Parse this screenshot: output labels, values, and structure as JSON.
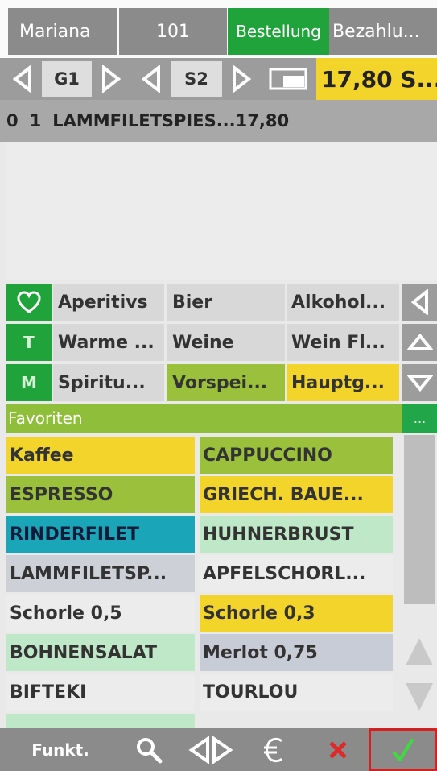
{
  "header": {
    "waiter": "Mariana",
    "table": "101",
    "tabs": [
      {
        "label": "Bestellung",
        "active": true
      },
      {
        "label": "Bezahlu...",
        "active": false
      }
    ]
  },
  "nav": {
    "group_label": "G1",
    "seat_label": "S2",
    "total": "17,80 S..."
  },
  "order": {
    "items": [
      {
        "col0": "0",
        "qty": "1",
        "name": "LAMMFILETSPIES...",
        "price": "17,80"
      }
    ]
  },
  "categories": {
    "rows": [
      {
        "icon": "heart-icon",
        "icon_text": "♡",
        "items": [
          "Aperitivs",
          "Bier",
          "Alkohol..."
        ]
      },
      {
        "icon": "t-icon",
        "icon_text": "T",
        "items": [
          "Warme ...",
          "Weine",
          "Wein Fl..."
        ]
      },
      {
        "icon": "m-icon",
        "icon_text": "M",
        "items": [
          "Spiritu...",
          "Vorspei...",
          "Hauptg..."
        ]
      }
    ],
    "favorites_label": "Favoriten",
    "favorites_more": "..."
  },
  "products": [
    {
      "label": "Kaffee",
      "color": "#f2d42a"
    },
    {
      "label": "CAPPUCCINO",
      "color": "#9bc13c"
    },
    {
      "label": "ESPRESSO",
      "color": "#9bc13c"
    },
    {
      "label": "GRIECH. BAUE...",
      "color": "#f2d42a"
    },
    {
      "label": "RINDERFILET",
      "color": "#1aa6b8"
    },
    {
      "label": "HUHNERBRUST",
      "color": "#bfe8c8"
    },
    {
      "label": "LAMMFILETSP...",
      "color": "#cdd0d6"
    },
    {
      "label": "APFELSCHORL...",
      "color": "#ececec"
    },
    {
      "label": "Schorle 0,5",
      "color": "#ececec"
    },
    {
      "label": "Schorle 0,3",
      "color": "#f2d42a"
    },
    {
      "label": "BOHNENSALAT",
      "color": "#bfe8c8"
    },
    {
      "label": "Merlot 0,75",
      "color": "#c8ccd6"
    },
    {
      "label": "BIFTEKI",
      "color": "#ececec"
    },
    {
      "label": "TOURLOU",
      "color": "#ececec"
    }
  ],
  "toolbar": {
    "funct_label": "Funkt.",
    "search_icon": "search-icon",
    "split_icon": "split-icon",
    "euro_icon": "euro-icon",
    "cancel_icon": "cancel-icon",
    "confirm_icon": "confirm-icon"
  },
  "colors": {
    "accent_green": "#1fa33a",
    "total_yellow": "#f2d42a",
    "confirm_border": "#d42020"
  }
}
